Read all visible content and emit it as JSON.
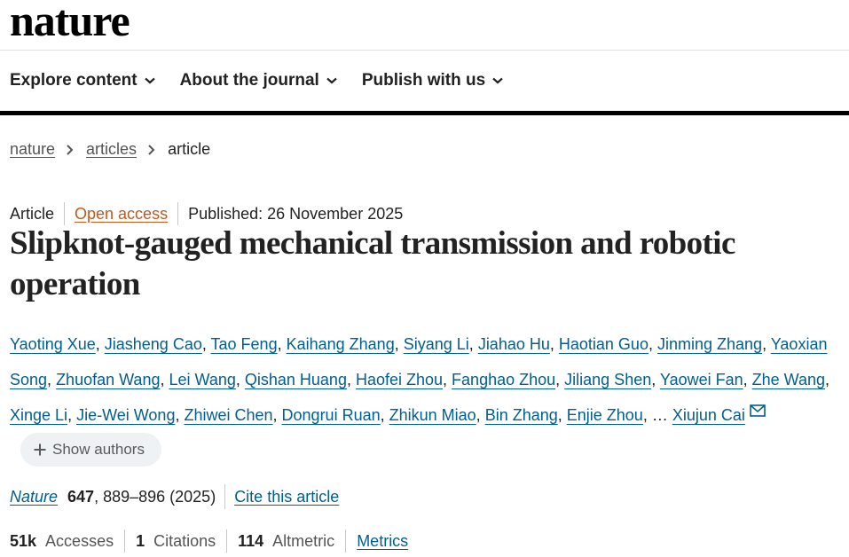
{
  "site": {
    "logo": "nature"
  },
  "nav": {
    "items": [
      {
        "label": "Explore content"
      },
      {
        "label": "About the journal"
      },
      {
        "label": "Publish with us"
      }
    ]
  },
  "breadcrumb": {
    "home": "nature",
    "section": "articles",
    "current": "article"
  },
  "article_meta": {
    "type": "Article",
    "open_access": "Open access",
    "published": "Published: 26 November 2025"
  },
  "title": "Slipknot-gauged mechanical transmission and robotic operation",
  "authors": {
    "list": [
      "Yaoting Xue",
      "Jiasheng Cao",
      "Tao Feng",
      "Kaihang Zhang",
      "Siyang Li",
      "Jiahao Hu",
      "Haotian Guo",
      "Jinming Zhang",
      "Yaoxian Song",
      "Zhuofan Wang",
      "Lei Wang",
      "Qishan Huang",
      "Haofei Zhou",
      "Fanghao Zhou",
      "Jiliang Shen",
      "Yaowei Fan",
      "Zhe Wang",
      "Xinge Li",
      "Jie-Wei Wong",
      "Zhiwei Chen",
      "Dongrui Ruan",
      "Zhikun Miao",
      "Bin Zhang",
      "Enjie Zhou"
    ],
    "ellipsis": "…",
    "last_author": "Xiujun Cai",
    "show_label": "Show authors"
  },
  "citation": {
    "journal": "Nature",
    "volume": "647",
    "pages_year": ", 889–896 (2025)",
    "cite_label": "Cite this article"
  },
  "metrics": {
    "accesses_value": "51k",
    "accesses_label": "Accesses",
    "citations_value": "1",
    "citations_label": "Citations",
    "altmetric_value": "114",
    "altmetric_label": "Altmetric",
    "metrics_link": "Metrics"
  },
  "colors": {
    "link": "#025e8d",
    "open_access": "#b85c20",
    "brand": "#000000"
  }
}
